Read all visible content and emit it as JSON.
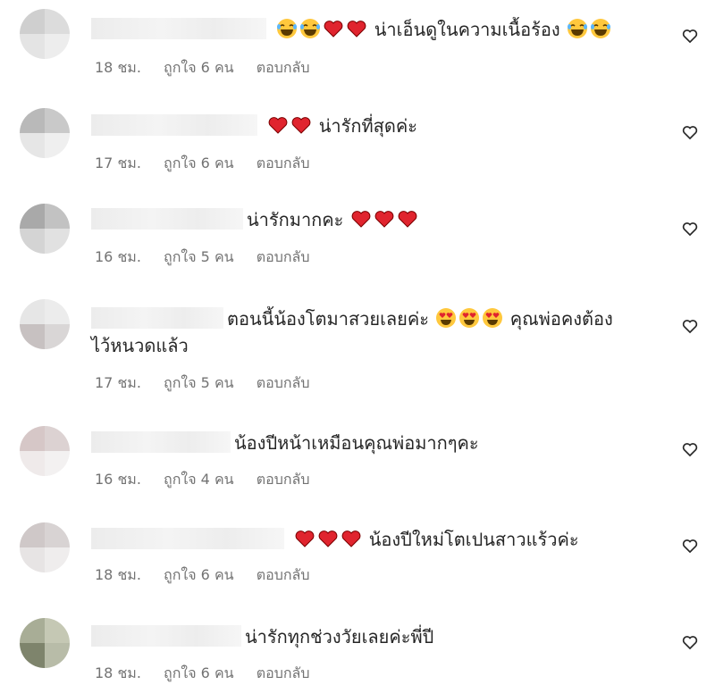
{
  "comments": [
    {
      "text": "น่าเอ็นดูในความเนื้อร้อง",
      "lead": [
        "laugh-cry-emoji",
        "laugh-cry-emoji",
        "red-heart-emoji",
        "red-heart-emoji"
      ],
      "tail": [
        "laugh-cry-emoji",
        "laugh-cry-emoji"
      ],
      "time": "18 ชม.",
      "likes": "ถูกใจ 6 คน",
      "reply": "ตอบกลับ"
    },
    {
      "text": "น่ารักที่สุดค่ะ",
      "lead": [
        "red-heart-emoji",
        "red-heart-emoji"
      ],
      "tail": [],
      "time": "17 ชม.",
      "likes": "ถูกใจ 6 คน",
      "reply": "ตอบกลับ"
    },
    {
      "text": "น่ารักมากคะ",
      "lead": [],
      "tail": [
        "red-heart-emoji",
        "red-heart-emoji",
        "red-heart-emoji"
      ],
      "time": "16 ชม.",
      "likes": "ถูกใจ 5 คน",
      "reply": "ตอบกลับ"
    },
    {
      "text": "ตอนนี้น้องโตมาสวยเลยค่ะ",
      "text_after": "คุณพ่อคงต้อง",
      "text_line2": "ไว้หนวดแล้ว",
      "lead": [],
      "tail": [
        "heart-eyes-emoji",
        "heart-eyes-emoji",
        "heart-eyes-emoji"
      ],
      "time": "17 ชม.",
      "likes": "ถูกใจ 5 คน",
      "reply": "ตอบกลับ"
    },
    {
      "text": "น้องปีหน้าเหมือนคุณพ่อมากๆคะ",
      "lead": [],
      "tail": [],
      "time": "16 ชม.",
      "likes": "ถูกใจ 4 คน",
      "reply": "ตอบกลับ"
    },
    {
      "text": "น้องปีใหม่โตเปนสาวแร้วค่ะ",
      "lead": [
        "red-heart-emoji",
        "red-heart-emoji",
        "red-heart-emoji"
      ],
      "tail": [],
      "time": "18 ชม.",
      "likes": "ถูกใจ 6 คน",
      "reply": "ตอบกลับ"
    },
    {
      "text": "น่ารักทุกช่วงวัยเลยค่ะพี่ปี",
      "lead": [],
      "tail": [],
      "time": "18 ชม.",
      "likes": "ถูกใจ 6 คน",
      "reply": "ตอบกลับ"
    }
  ],
  "icons": {
    "like": "heart-outline-icon"
  },
  "colors": {
    "text": "#262626",
    "meta": "#737373",
    "heart": "#e0245e"
  }
}
